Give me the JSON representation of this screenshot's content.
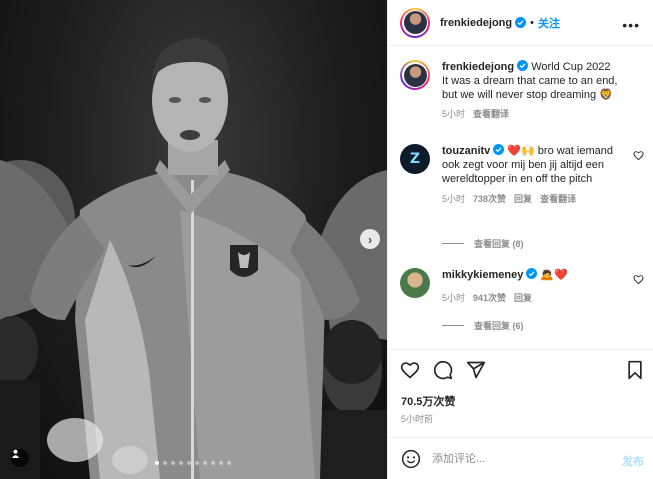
{
  "post": {
    "author": "frenkiedejong",
    "follow_label": "关注",
    "separator": "•",
    "more_label": "•••"
  },
  "caption": {
    "username": "frenkiedejong",
    "title": "World Cup 2022",
    "text": "It was a dream that came to an end, but we will never stop dreaming 🦁",
    "time": "5小时",
    "translate_label": "查看翻译"
  },
  "comments": [
    {
      "username": "touzanitv",
      "text": "❤️🙌 bro wat iemand ook zegt voor mij ben jij altijd een wereldtopper in en off the pitch",
      "time": "5小时",
      "likes": "738次赞",
      "reply_label": "回复",
      "translate_label": "查看翻译",
      "replies_label": "查看回复 (8)"
    },
    {
      "username": "mikkykiemeney",
      "text": "🙇❤️",
      "time": "5小时",
      "likes": "941次赞",
      "reply_label": "回复",
      "replies_label": "查看回复 (6)"
    }
  ],
  "stats": {
    "likes": "70.5万次赞",
    "time": "5小时前"
  },
  "composer": {
    "placeholder": "添加评论...",
    "post_label": "发布"
  },
  "carousel": {
    "slides": 10,
    "active": 1
  },
  "colors": {
    "accent": "#0095f6",
    "post_disabled": "#b2dffc",
    "verified": "#0095f6",
    "muted": "#8e8e8e"
  }
}
